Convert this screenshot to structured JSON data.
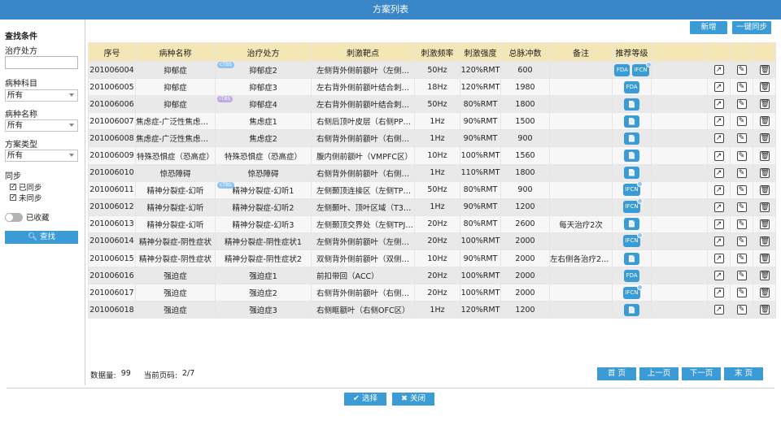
{
  "window": {
    "title": "方案列表"
  },
  "sidebar": {
    "heading": "查找条件",
    "filters": [
      {
        "label": "治疗处方",
        "type": "input",
        "value": ""
      },
      {
        "label": "病种科目",
        "type": "select",
        "value": "所有"
      },
      {
        "label": "病种名称",
        "type": "select",
        "value": "所有"
      },
      {
        "label": "方案类型",
        "type": "select",
        "value": "所有"
      }
    ],
    "sync_label": "同步",
    "sync_options": [
      {
        "label": "已同步",
        "checked": true
      },
      {
        "label": "未同步",
        "checked": true
      }
    ],
    "favorite_label": "已收藏",
    "search_button": "查找"
  },
  "toolbar": {
    "add_label": "新增",
    "sync_all_label": "一键同步"
  },
  "table": {
    "columns": [
      "序号",
      "病种名称",
      "治疗处方",
      "刺激靶点",
      "刺激频率",
      "刺激强度",
      "总脉冲数",
      "备注",
      "推荐等级"
    ],
    "rows": [
      {
        "id": "201006004",
        "disease": "抑郁症",
        "prescription": "抑郁症2",
        "tag": "cTBS",
        "target": "左侧背外侧前额叶（左侧DL…",
        "freq": "50Hz",
        "intensity": "120%RMT",
        "pulses": "600",
        "note": "",
        "rec": [
          {
            "type": "FDA"
          },
          {
            "type": "IFCN",
            "dot": true
          }
        ]
      },
      {
        "id": "201006005",
        "disease": "抑郁症",
        "prescription": "抑郁症3",
        "tag": "",
        "target": "左右背外侧前额叶结合刺激…",
        "freq": "18Hz",
        "intensity": "120%RMT",
        "pulses": "1980",
        "note": "",
        "rec": [
          {
            "type": "FDA"
          }
        ]
      },
      {
        "id": "201006006",
        "disease": "抑郁症",
        "prescription": "抑郁症4",
        "tag": "iTBS",
        "target": "左右背外侧前额叶结合刺激…",
        "freq": "50Hz",
        "intensity": "80%RMT",
        "pulses": "1800",
        "note": "",
        "rec": [
          {
            "type": "doc"
          }
        ]
      },
      {
        "id": "201006007",
        "disease": "焦虑症-广泛性焦虑障碍",
        "prescription": "焦虑症1",
        "tag": "",
        "target": "右侧后顶叶皮层（右侧PPC…",
        "freq": "1Hz",
        "intensity": "90%RMT",
        "pulses": "1500",
        "note": "",
        "rec": [
          {
            "type": "doc"
          }
        ]
      },
      {
        "id": "201006008",
        "disease": "焦虑症-广泛性焦虑障碍",
        "prescription": "焦虑症2",
        "tag": "",
        "target": "右侧背外侧前额叶（右侧DL…",
        "freq": "1Hz",
        "intensity": "90%RMT",
        "pulses": "900",
        "note": "",
        "rec": [
          {
            "type": "doc"
          }
        ]
      },
      {
        "id": "201006009",
        "disease": "特殊恐惧症（恐高症）",
        "prescription": "特殊恐惧症（恐高症）",
        "tag": "",
        "target": "腹内侧前额叶（VMPFC区）",
        "freq": "10Hz",
        "intensity": "100%RMT",
        "pulses": "1560",
        "note": "",
        "rec": [
          {
            "type": "doc"
          }
        ]
      },
      {
        "id": "201006010",
        "disease": "惊恐障碍",
        "prescription": "惊恐障碍",
        "tag": "",
        "target": "右侧背外侧前额叶（右侧DL…",
        "freq": "1Hz",
        "intensity": "110%RMT",
        "pulses": "1800",
        "note": "",
        "rec": [
          {
            "type": "doc"
          }
        ]
      },
      {
        "id": "201006011",
        "disease": "精神分裂症-幻听",
        "prescription": "精神分裂症-幻听1",
        "tag": "cTBS",
        "target": "左侧颞顶连接区（左侧TPC…",
        "freq": "50Hz",
        "intensity": "80%RMT",
        "pulses": "900",
        "note": "",
        "rec": [
          {
            "type": "IFCN",
            "dot": true
          }
        ]
      },
      {
        "id": "201006012",
        "disease": "精神分裂症-幻听",
        "prescription": "精神分裂症-幻听2",
        "tag": "",
        "target": "左侧颞叶、顶叶区域（T3、…",
        "freq": "1Hz",
        "intensity": "90%RMT",
        "pulses": "1200",
        "note": "",
        "rec": [
          {
            "type": "IFCN",
            "dot": true
          }
        ]
      },
      {
        "id": "201006013",
        "disease": "精神分裂症-幻听",
        "prescription": "精神分裂症-幻听3",
        "tag": "",
        "target": "左侧颞顶交界处（左侧TPJ…",
        "freq": "20Hz",
        "intensity": "80%RMT",
        "pulses": "2600",
        "note": "每天治疗2次",
        "rec": [
          {
            "type": "doc"
          }
        ]
      },
      {
        "id": "201006014",
        "disease": "精神分裂症-阴性症状",
        "prescription": "精神分裂症-阴性症状1",
        "tag": "",
        "target": "左侧背外侧前额叶（左侧DL…",
        "freq": "20Hz",
        "intensity": "100%RMT",
        "pulses": "2000",
        "note": "",
        "rec": [
          {
            "type": "IFCN",
            "dot": true
          }
        ]
      },
      {
        "id": "201006015",
        "disease": "精神分裂症-阴性症状",
        "prescription": "精神分裂症-阴性症状2",
        "tag": "",
        "target": "双侧背外侧前额叶（双侧DL…",
        "freq": "10Hz",
        "intensity": "90%RMT",
        "pulses": "2000",
        "note": "左右侧各治疗2000",
        "rec": [
          {
            "type": "doc"
          }
        ]
      },
      {
        "id": "201006016",
        "disease": "强迫症",
        "prescription": "强迫症1",
        "tag": "",
        "target": "前扣带回（ACC）",
        "freq": "20Hz",
        "intensity": "100%RMT",
        "pulses": "2000",
        "note": "",
        "rec": [
          {
            "type": "FDA"
          }
        ]
      },
      {
        "id": "201006017",
        "disease": "强迫症",
        "prescription": "强迫症2",
        "tag": "",
        "target": "右侧背外侧前额叶（右侧DL…",
        "freq": "20Hz",
        "intensity": "100%RMT",
        "pulses": "2000",
        "note": "",
        "rec": [
          {
            "type": "IFCN",
            "dot": true
          }
        ]
      },
      {
        "id": "201006018",
        "disease": "强迫症",
        "prescription": "强迫症3",
        "tag": "",
        "target": "右侧眶额叶（右侧OFC区）",
        "freq": "1Hz",
        "intensity": "120%RMT",
        "pulses": "1200",
        "note": "",
        "rec": [
          {
            "type": "doc"
          }
        ]
      }
    ]
  },
  "footer": {
    "count_label": "数据量:",
    "count_value": "99",
    "page_label": "当前页码:",
    "page_value": "2/7",
    "pager": [
      "首 页",
      "上一页",
      "下一页",
      "末 页"
    ],
    "select_label": "选择",
    "close_label": "关闭"
  },
  "icons": {
    "doc": "📄",
    "export": "↗",
    "edit": "✎",
    "delete": "🗑"
  }
}
